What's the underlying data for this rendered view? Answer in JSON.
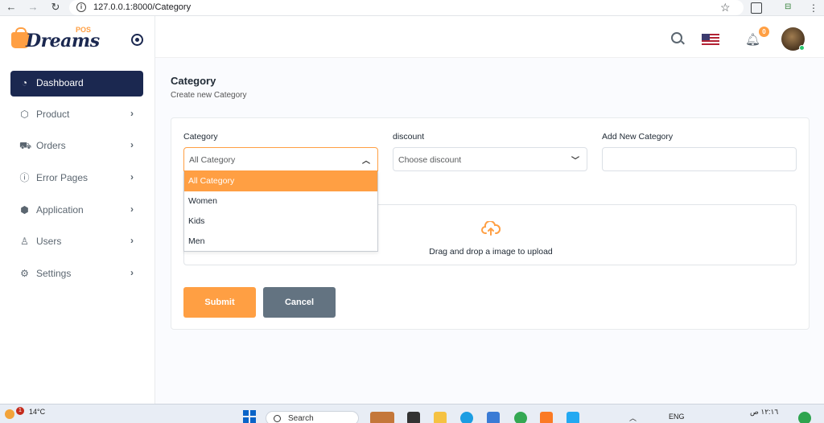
{
  "browser": {
    "url": "127.0.0.1:8000/Category"
  },
  "brand": {
    "logo_text": "Dreams",
    "logo_sup": "POS"
  },
  "sidebar": {
    "items": [
      {
        "label": "Dashboard",
        "icon": "dashboard-icon",
        "active": true
      },
      {
        "label": "Product",
        "icon": "box-icon"
      },
      {
        "label": "Orders",
        "icon": "cart-icon"
      },
      {
        "label": "Error Pages",
        "icon": "alert-circle-icon"
      },
      {
        "label": "Application",
        "icon": "cube-icon"
      },
      {
        "label": "Users",
        "icon": "user-icon"
      },
      {
        "label": "Settings",
        "icon": "gear-icon"
      }
    ]
  },
  "header": {
    "notification_count": "0"
  },
  "page": {
    "title": "Category",
    "subtitle": "Create new Category"
  },
  "form": {
    "category_label": "Category",
    "category_value": "All Category",
    "category_options": [
      "All Category",
      "Women",
      "Kids",
      "Men"
    ],
    "discount_label": "discount",
    "discount_value": "Choose discount",
    "new_category_label": "Add New Category",
    "new_category_value": "",
    "upload_text": "Drag and drop a image to upload",
    "submit_label": "Submit",
    "cancel_label": "Cancel"
  },
  "taskbar": {
    "temperature": "14°C",
    "weather_badge": "1",
    "search_placeholder": "Search",
    "language": "ENG",
    "time": "١٢:١٦ ص"
  },
  "colors": {
    "accent": "#ff9f43",
    "sidebar_active": "#1b2850",
    "cancel": "#637381"
  }
}
